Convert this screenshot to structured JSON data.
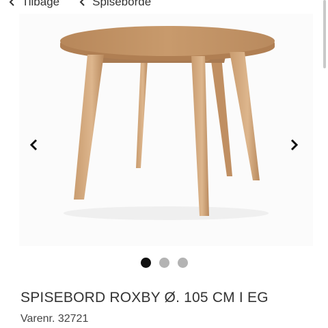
{
  "breadcrumb": {
    "back_label": "Tilbage",
    "parent_label": "Spiseborde"
  },
  "gallery": {
    "image_count": 3,
    "active_index": 0,
    "image_alt_icon": "round-wooden-table"
  },
  "product": {
    "title": "SPISEBORD ROXBY Ø. 105 CM I EG",
    "sku_label": "Varenr.",
    "sku_value": "32721"
  },
  "colors": {
    "active_dot": "#111111",
    "inactive_dot": "#b3b3b3",
    "oak": "#c79a6b"
  }
}
